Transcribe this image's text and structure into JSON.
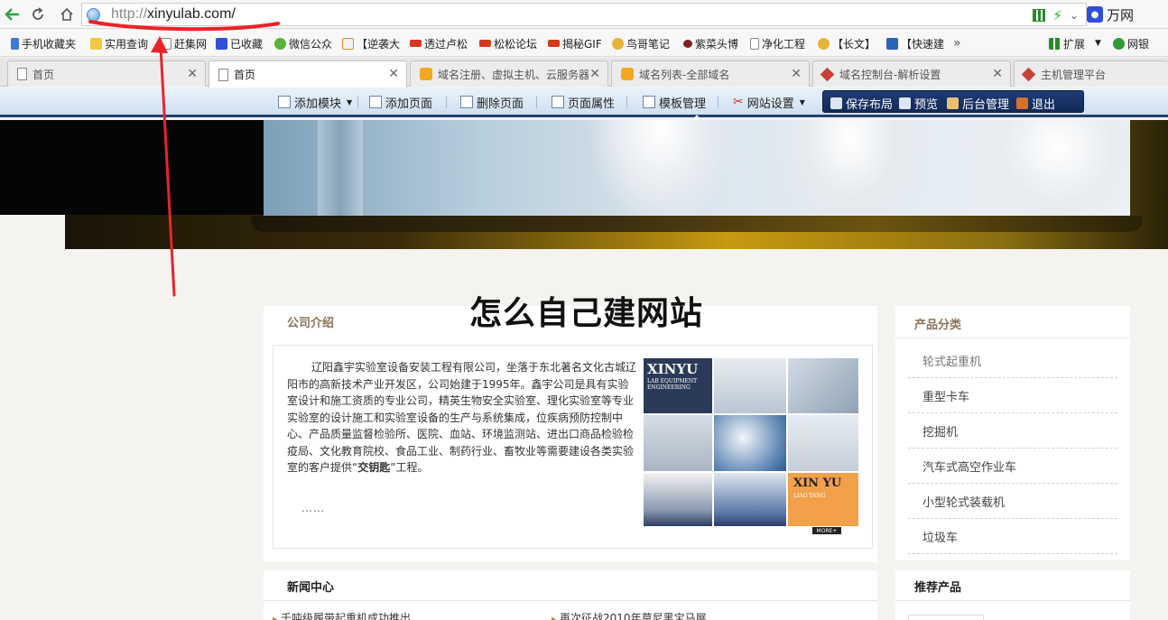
{
  "browser": {
    "url_protocol": "http://",
    "url_host": "xinyulab.com/",
    "search_engine": "万网"
  },
  "bookmarks": [
    "手机收藏夹",
    "实用查询",
    "赶集网",
    "已收藏",
    "微信公众",
    "【逆袭大",
    "透过卢松",
    "松松论坛",
    "揭秘GIF",
    "鸟哥笔记",
    "紫菜头博",
    "净化工程",
    "【长文】",
    "【快速建"
  ],
  "bookmarks_right": {
    "more": "»",
    "extensions": "扩展",
    "bank": "网银"
  },
  "tabs": [
    {
      "label": "首页",
      "active": false,
      "icon": "page-icon"
    },
    {
      "label": "首页",
      "active": true,
      "icon": "page-icon"
    },
    {
      "label": "域名注册、虚拟主机、云服务器",
      "active": false,
      "icon": "wanwang-icon"
    },
    {
      "label": "域名列表-全部域名",
      "active": false,
      "icon": "wanwang-icon"
    },
    {
      "label": "域名控制台-解析设置",
      "active": false,
      "icon": "aliyun-icon"
    },
    {
      "label": "主机管理平台",
      "active": false,
      "icon": "aliyun-icon"
    }
  ],
  "site_toolbar": {
    "add_module": "添加模块",
    "add_page": "添加页面",
    "delete_page": "删除页面",
    "page_props": "页面属性",
    "template_mgmt": "模板管理",
    "site_settings": "网站设置",
    "save_layout": "保存布局",
    "preview": "预览",
    "admin": "后台管理",
    "logout": "退出"
  },
  "headline": "怎么自己建网站",
  "about": {
    "title": "公司介绍",
    "text_before_bold": "辽阳鑫宇实验室设备安装工程有限公司，坐落于东北著名文化古城辽阳市的高新技术产业开发区，公司始建于1995年。鑫宇公司是具有实验室设计和施工资质的专业公司，精英生物安全实验室、理化实验室等专业实验室的设计施工和实验室设备的生产与系统集成，位疾病预防控制中心、产品质量监督检验所、医院、血站、环境监测站、进出口商品检验检疫局、文化教育院校、食品工业、制药行业、畜牧业等需要建设各类实验室的客户提供“",
    "bold": "交钥匙",
    "text_after_bold": "”工程。",
    "ellipsis": "……",
    "collage_brand_1": "XINYU",
    "collage_brand_1_sub": "LAB EQUIPMENT ENGINEERING",
    "collage_brand_2": "XIN YU",
    "collage_brand_2_sub": "LIAO YANG",
    "more": "MORE+"
  },
  "categories": {
    "title": "产品分类",
    "items": [
      "轮式起重机",
      "重型卡车",
      "挖掘机",
      "汽车式高空作业车",
      "小型轮式装载机",
      "垃圾车"
    ]
  },
  "news": {
    "title": "新闻中心",
    "items": [
      "千吨级履带起重机成功推出",
      "再次征战2010年莫尼黑宝马展"
    ]
  },
  "recommend": {
    "title": "推荐产品"
  },
  "colors": {
    "toolbar_dark": "#1e3b75",
    "annotation_red": "#e8242a",
    "panel_title": "#8a7358",
    "accent_orange": "#f2a14a"
  }
}
